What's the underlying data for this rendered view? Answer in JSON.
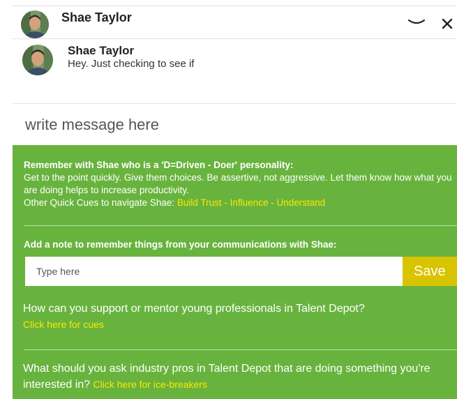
{
  "header": {
    "name": "Shae Taylor"
  },
  "message": {
    "sender": "Shae Taylor",
    "preview": "Hey. Just checking to see if"
  },
  "compose": {
    "placeholder": "write message here"
  },
  "personality": {
    "title": "Remember with Shae who is a 'D=Driven - Doer' personality:",
    "advice": "Get to the point quickly. Give them choices. Be assertive, not aggressive. Let them know how what you are doing helps to increase productivity.",
    "cues_label": "Other Quick Cues to navigate Shae:",
    "cues_links": "Build Trust - Influence - Understand"
  },
  "note": {
    "label": "Add a note to remember things from your communications with Shae:",
    "placeholder": "Type here",
    "save_label": "Save"
  },
  "questions": [
    {
      "text": "How can you support or mentor young professionals in Talent Depot?",
      "link": "Click here for cues"
    },
    {
      "text": "What should you ask industry pros in Talent Depot that are doing something you're interested in?",
      "link": "Click here for ice-breakers"
    }
  ],
  "icons": {
    "minimize": "chevron-down-icon",
    "close": "close-icon",
    "avatar": "avatar-photo"
  },
  "colors": {
    "panel_green": "#68b33e",
    "link_yellow": "#ffe600",
    "save_button": "#d8c400"
  }
}
